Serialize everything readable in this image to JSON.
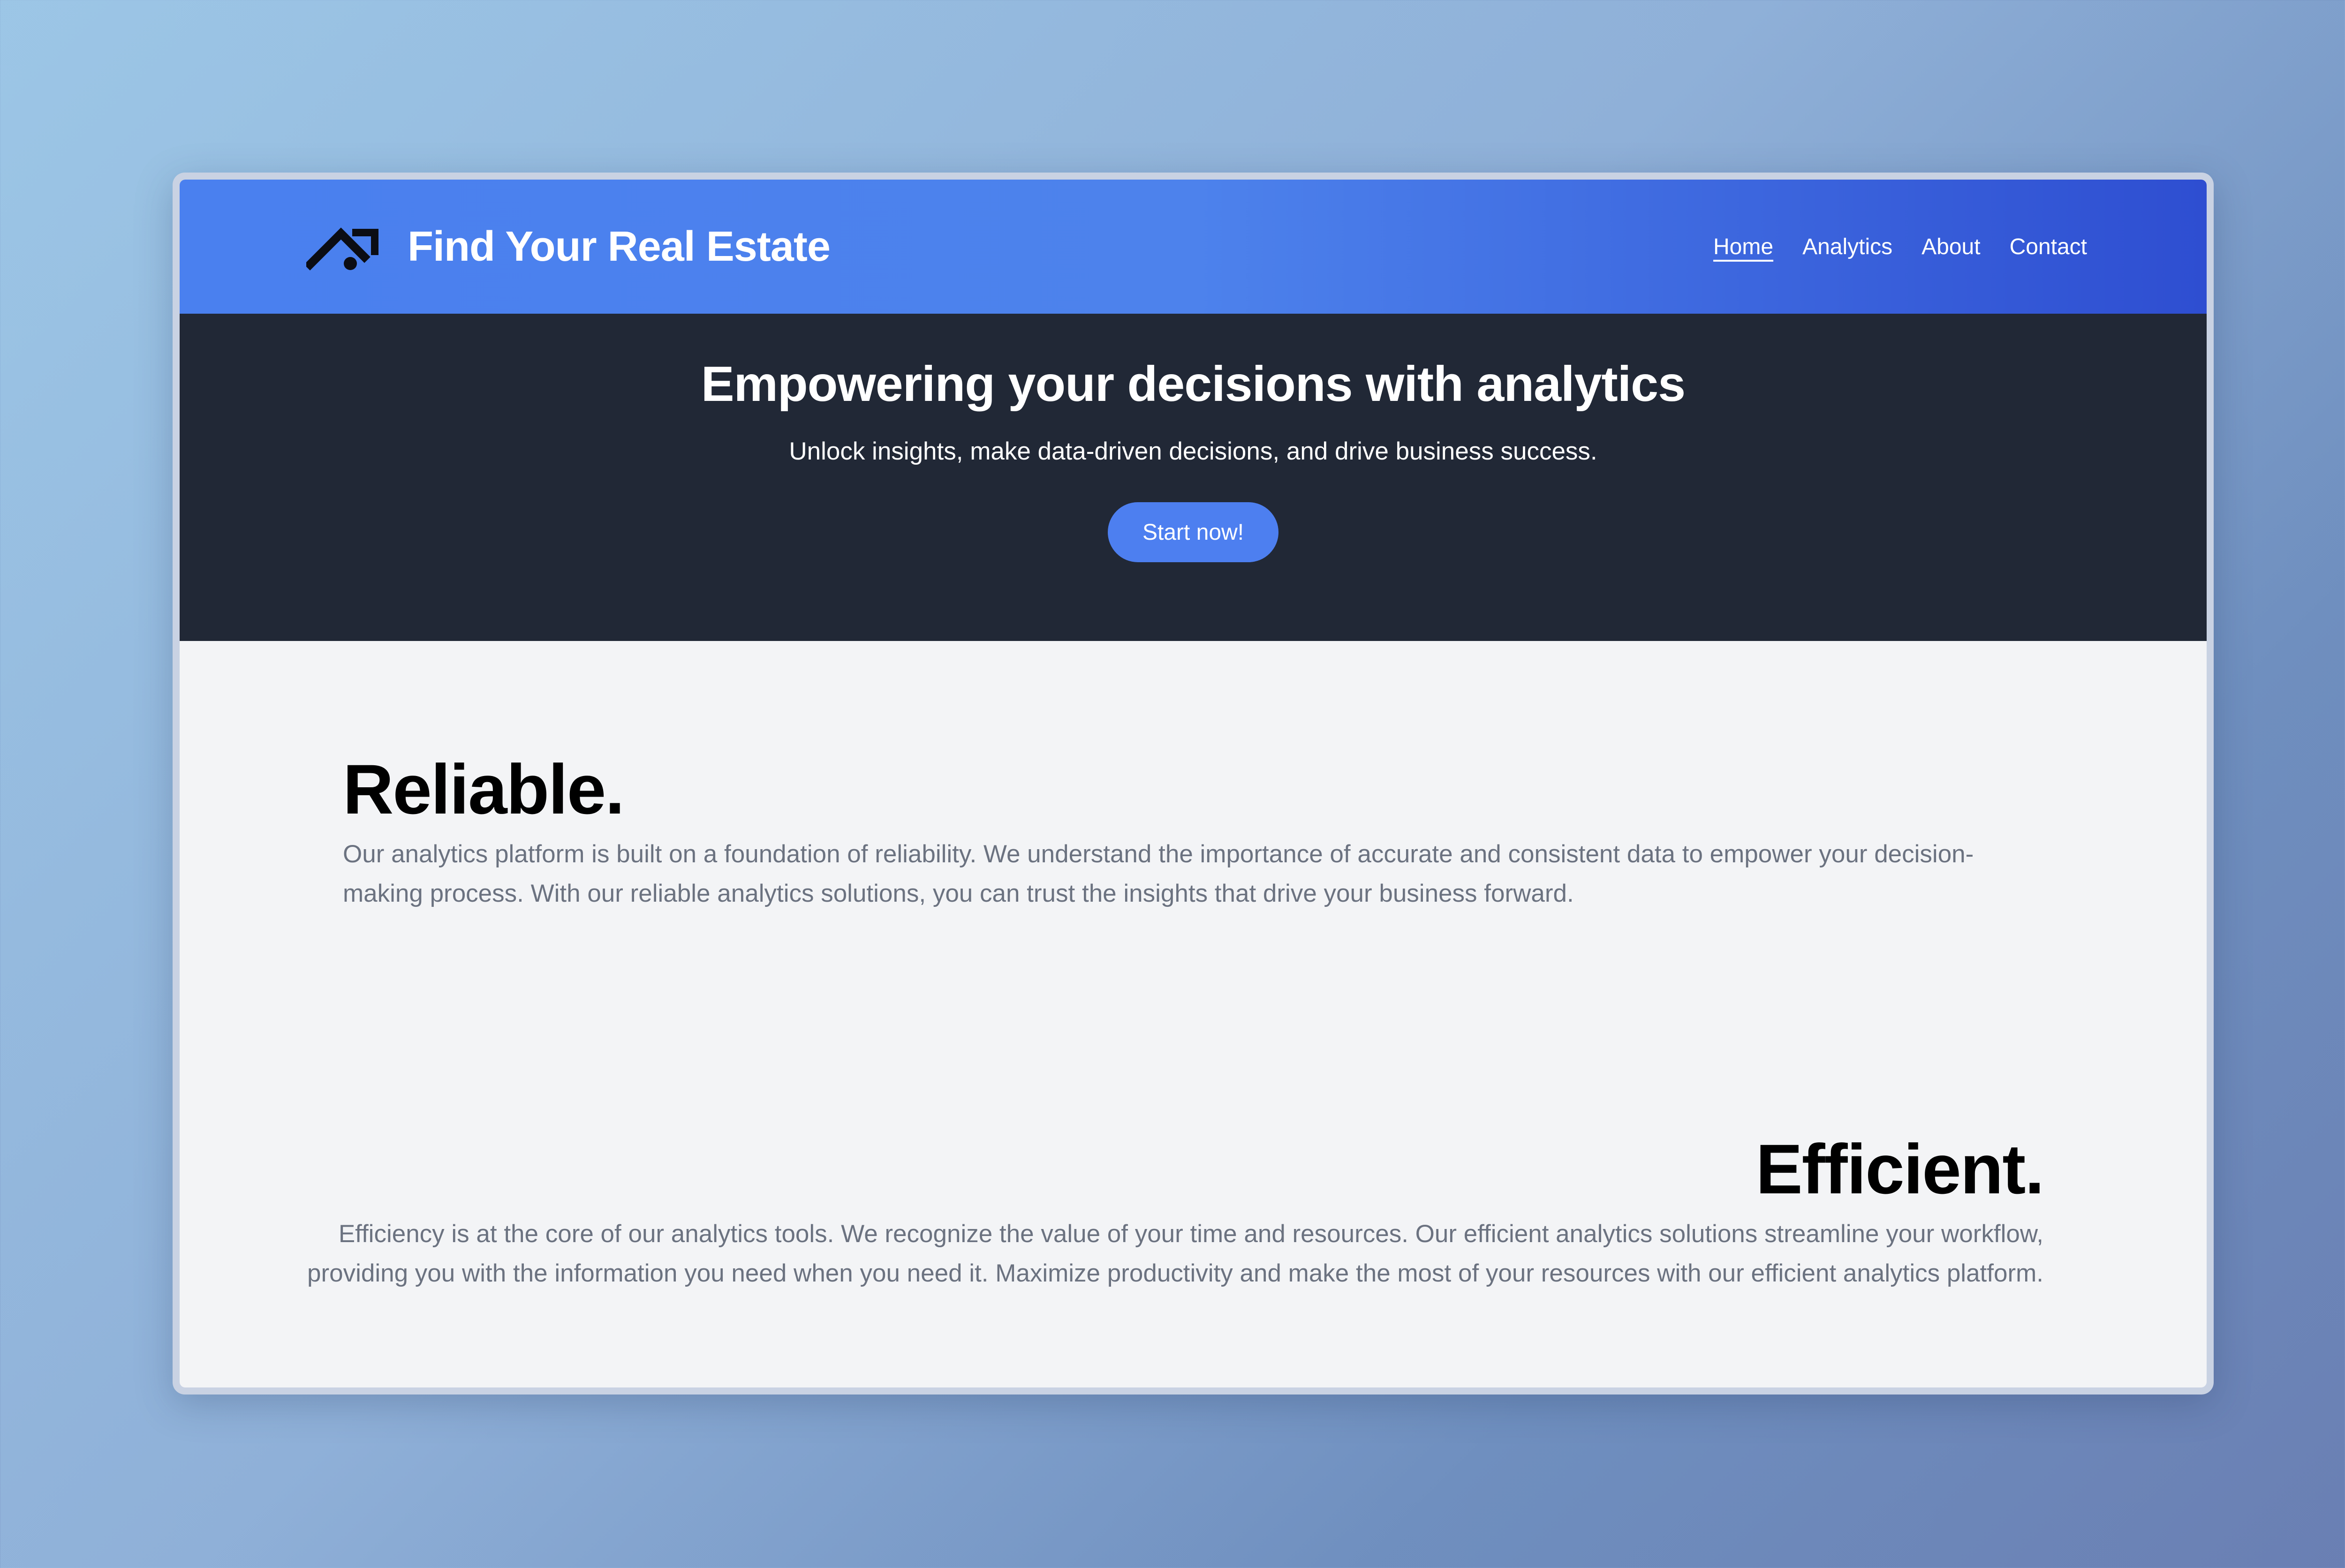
{
  "header": {
    "logo_icon": "house-roof-icon",
    "brand": "Find Your Real Estate",
    "nav": [
      {
        "label": "Home",
        "active": true
      },
      {
        "label": "Analytics",
        "active": false
      },
      {
        "label": "About",
        "active": false
      },
      {
        "label": "Contact",
        "active": false
      }
    ]
  },
  "hero": {
    "title": "Empowering your decisions with analytics",
    "subtitle": "Unlock insights, make data-driven decisions, and drive business success.",
    "cta_label": "Start now!"
  },
  "sections": {
    "reliable": {
      "heading": "Reliable.",
      "body": "Our analytics platform is built on a foundation of reliability. We understand the importance of accurate and consistent data to empower your decision-making process. With our reliable analytics solutions, you can trust the insights that drive your business forward."
    },
    "efficient": {
      "heading": "Efficient.",
      "body": "Efficiency is at the core of our analytics tools. We recognize the value of your time and resources. Our efficient analytics solutions streamline your workflow, providing you with the information you need when you need it. Maximize productivity and make the most of your resources with our efficient analytics platform."
    }
  },
  "colors": {
    "nav_gradient_start": "#4a80ef",
    "nav_gradient_end": "#2e4ed1",
    "hero_bg": "#212836",
    "cta_bg": "#4d7ff0",
    "content_bg": "#f3f4f6",
    "body_text": "#6b7280"
  }
}
